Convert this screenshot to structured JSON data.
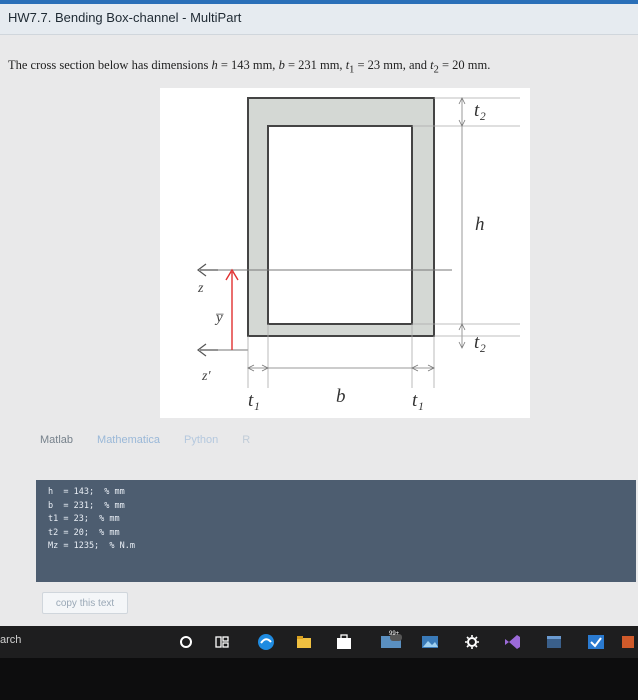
{
  "window": {
    "title": "HW7.7. Bending Box-channel - MultiPart"
  },
  "problem": {
    "intro": "The cross section below has dimensions",
    "h_label": "h",
    "h_value": "= 143 mm,",
    "b_label": "b",
    "b_value": "= 231 mm,",
    "t1_label": "t",
    "t1_sub": "1",
    "t1_value": "= 23 mm, and",
    "t2_label": "t",
    "t2_sub": "2",
    "t2_value": "= 20 mm."
  },
  "figure_labels": {
    "t2_top": "t₂",
    "h": "h",
    "t2_bottom": "t₂",
    "z": "z",
    "ybar": "y̅",
    "zprime": "z′",
    "t1_left": "t₁",
    "b": "b",
    "t1_right": "t₁"
  },
  "tabs": [
    {
      "label": "Matlab"
    },
    {
      "label": "Mathematica"
    },
    {
      "label": "Python"
    },
    {
      "label": "R"
    }
  ],
  "code_lines": [
    "h  = 143;  % mm",
    "b  = 231;  % mm",
    "t1 = 23;  % mm",
    "t2 = 20;  % mm",
    "Mz = 1235;  % N.m"
  ],
  "copy_button": "copy this text",
  "taskbar": {
    "search": "arch",
    "badge": "99+"
  },
  "colors": {
    "accent": "#2a6fb8",
    "code_bg": "#4d5d70",
    "ybar_arrow": "#e03030"
  }
}
